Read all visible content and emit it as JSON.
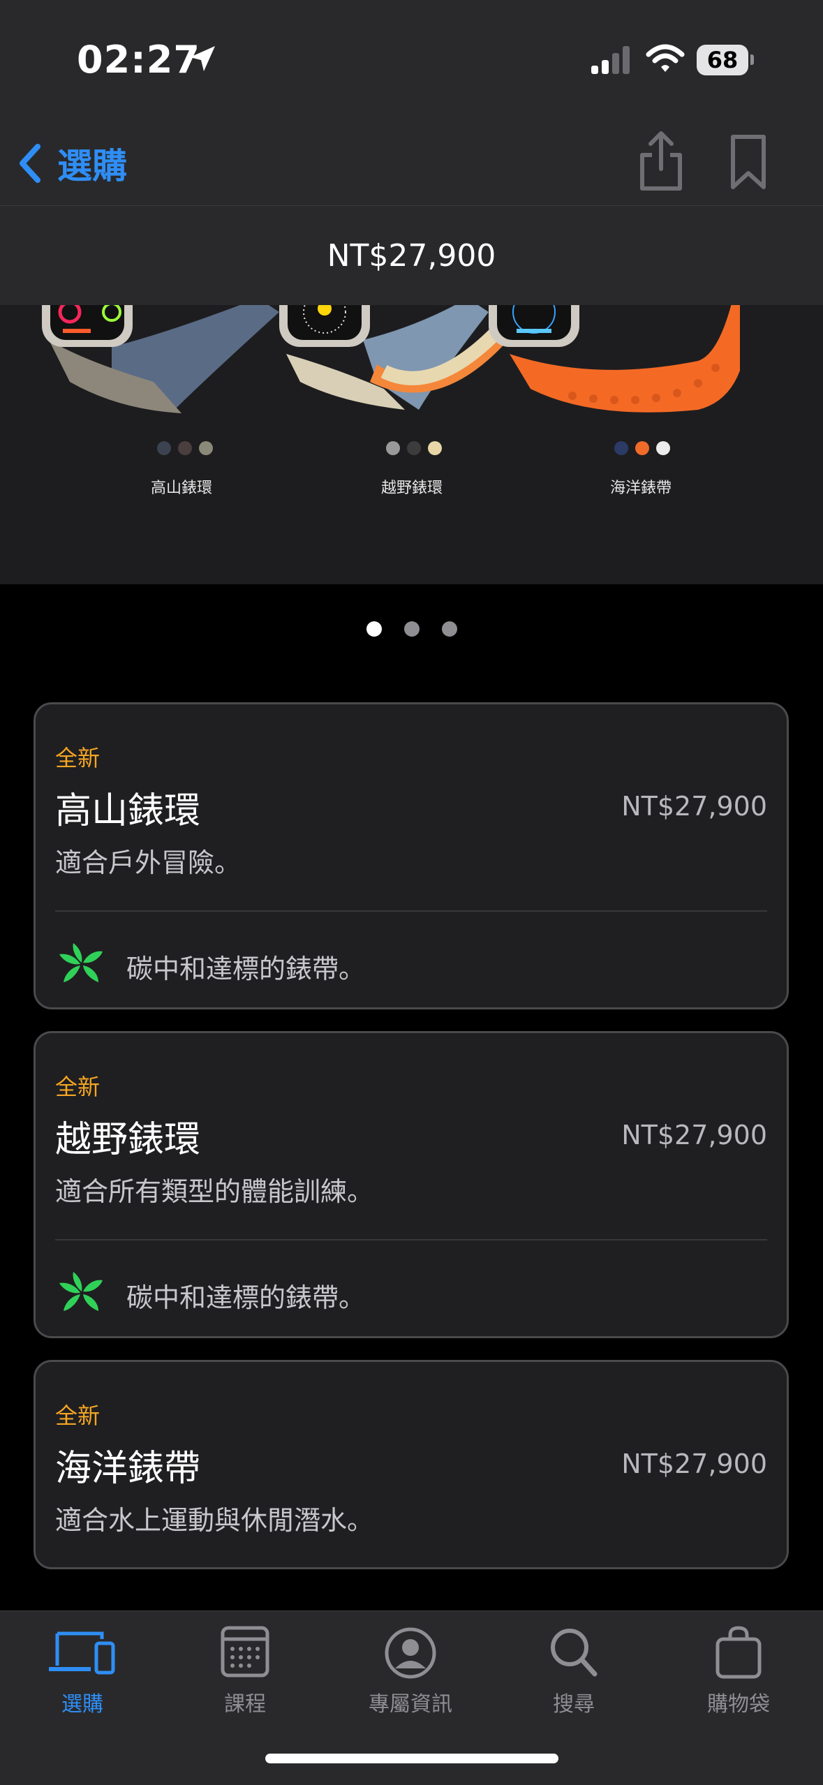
{
  "status_bar": {
    "time": "02:27",
    "battery": "68"
  },
  "nav": {
    "back_label": "選購"
  },
  "price_bar": {
    "price": "NT$27,900"
  },
  "hero": {
    "variants": [
      {
        "label": "高山錶環",
        "swatches": [
          "#3b4250",
          "#4a3f3e",
          "#8b8a78"
        ]
      },
      {
        "label": "越野錶環",
        "swatches": [
          "#9a9a9a",
          "#3c3c3c",
          "#e9d6a8"
        ]
      },
      {
        "label": "海洋錶帶",
        "swatches": [
          "#2c3a66",
          "#f06a2a",
          "#ececec"
        ]
      }
    ]
  },
  "pager": {
    "count": 3,
    "active": 0
  },
  "cards": [
    {
      "badge": "全新",
      "title": "高山錶環",
      "price": "NT$27,900",
      "desc": "適合戶外冒險。",
      "eco": "碳中和達標的錶帶。"
    },
    {
      "badge": "全新",
      "title": "越野錶環",
      "price": "NT$27,900",
      "desc": "適合所有類型的體能訓練。",
      "eco": "碳中和達標的錶帶。"
    },
    {
      "badge": "全新",
      "title": "海洋錶帶",
      "price": "NT$27,900",
      "desc": "適合水上運動與休閒潛水。"
    }
  ],
  "tabbar": {
    "tabs": [
      {
        "label": "選購",
        "icon": "devices-icon",
        "active": true
      },
      {
        "label": "課程",
        "icon": "calendar-icon",
        "active": false
      },
      {
        "label": "專屬資訊",
        "icon": "person-circle-icon",
        "active": false
      },
      {
        "label": "搜尋",
        "icon": "search-icon",
        "active": false
      },
      {
        "label": "購物袋",
        "icon": "bag-icon",
        "active": false
      }
    ]
  },
  "colors": {
    "accent": "#2f8ef5",
    "badge": "#f5a623",
    "eco": "#30d158",
    "background": "#000000",
    "surface": "#29292b"
  }
}
